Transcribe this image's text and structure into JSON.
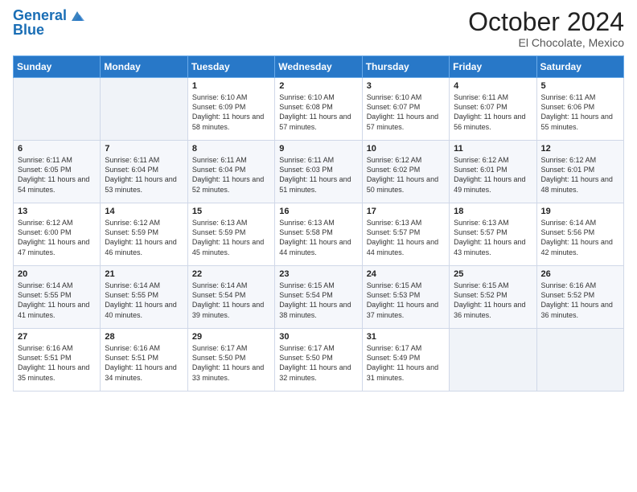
{
  "header": {
    "logo_general": "General",
    "logo_blue": "Blue",
    "month": "October 2024",
    "location": "El Chocolate, Mexico"
  },
  "days_of_week": [
    "Sunday",
    "Monday",
    "Tuesday",
    "Wednesday",
    "Thursday",
    "Friday",
    "Saturday"
  ],
  "weeks": [
    [
      {
        "day": "",
        "info": ""
      },
      {
        "day": "",
        "info": ""
      },
      {
        "day": "1",
        "info": "Sunrise: 6:10 AM\nSunset: 6:09 PM\nDaylight: 11 hours and 58 minutes."
      },
      {
        "day": "2",
        "info": "Sunrise: 6:10 AM\nSunset: 6:08 PM\nDaylight: 11 hours and 57 minutes."
      },
      {
        "day": "3",
        "info": "Sunrise: 6:10 AM\nSunset: 6:07 PM\nDaylight: 11 hours and 57 minutes."
      },
      {
        "day": "4",
        "info": "Sunrise: 6:11 AM\nSunset: 6:07 PM\nDaylight: 11 hours and 56 minutes."
      },
      {
        "day": "5",
        "info": "Sunrise: 6:11 AM\nSunset: 6:06 PM\nDaylight: 11 hours and 55 minutes."
      }
    ],
    [
      {
        "day": "6",
        "info": "Sunrise: 6:11 AM\nSunset: 6:05 PM\nDaylight: 11 hours and 54 minutes."
      },
      {
        "day": "7",
        "info": "Sunrise: 6:11 AM\nSunset: 6:04 PM\nDaylight: 11 hours and 53 minutes."
      },
      {
        "day": "8",
        "info": "Sunrise: 6:11 AM\nSunset: 6:04 PM\nDaylight: 11 hours and 52 minutes."
      },
      {
        "day": "9",
        "info": "Sunrise: 6:11 AM\nSunset: 6:03 PM\nDaylight: 11 hours and 51 minutes."
      },
      {
        "day": "10",
        "info": "Sunrise: 6:12 AM\nSunset: 6:02 PM\nDaylight: 11 hours and 50 minutes."
      },
      {
        "day": "11",
        "info": "Sunrise: 6:12 AM\nSunset: 6:01 PM\nDaylight: 11 hours and 49 minutes."
      },
      {
        "day": "12",
        "info": "Sunrise: 6:12 AM\nSunset: 6:01 PM\nDaylight: 11 hours and 48 minutes."
      }
    ],
    [
      {
        "day": "13",
        "info": "Sunrise: 6:12 AM\nSunset: 6:00 PM\nDaylight: 11 hours and 47 minutes."
      },
      {
        "day": "14",
        "info": "Sunrise: 6:12 AM\nSunset: 5:59 PM\nDaylight: 11 hours and 46 minutes."
      },
      {
        "day": "15",
        "info": "Sunrise: 6:13 AM\nSunset: 5:59 PM\nDaylight: 11 hours and 45 minutes."
      },
      {
        "day": "16",
        "info": "Sunrise: 6:13 AM\nSunset: 5:58 PM\nDaylight: 11 hours and 44 minutes."
      },
      {
        "day": "17",
        "info": "Sunrise: 6:13 AM\nSunset: 5:57 PM\nDaylight: 11 hours and 44 minutes."
      },
      {
        "day": "18",
        "info": "Sunrise: 6:13 AM\nSunset: 5:57 PM\nDaylight: 11 hours and 43 minutes."
      },
      {
        "day": "19",
        "info": "Sunrise: 6:14 AM\nSunset: 5:56 PM\nDaylight: 11 hours and 42 minutes."
      }
    ],
    [
      {
        "day": "20",
        "info": "Sunrise: 6:14 AM\nSunset: 5:55 PM\nDaylight: 11 hours and 41 minutes."
      },
      {
        "day": "21",
        "info": "Sunrise: 6:14 AM\nSunset: 5:55 PM\nDaylight: 11 hours and 40 minutes."
      },
      {
        "day": "22",
        "info": "Sunrise: 6:14 AM\nSunset: 5:54 PM\nDaylight: 11 hours and 39 minutes."
      },
      {
        "day": "23",
        "info": "Sunrise: 6:15 AM\nSunset: 5:54 PM\nDaylight: 11 hours and 38 minutes."
      },
      {
        "day": "24",
        "info": "Sunrise: 6:15 AM\nSunset: 5:53 PM\nDaylight: 11 hours and 37 minutes."
      },
      {
        "day": "25",
        "info": "Sunrise: 6:15 AM\nSunset: 5:52 PM\nDaylight: 11 hours and 36 minutes."
      },
      {
        "day": "26",
        "info": "Sunrise: 6:16 AM\nSunset: 5:52 PM\nDaylight: 11 hours and 36 minutes."
      }
    ],
    [
      {
        "day": "27",
        "info": "Sunrise: 6:16 AM\nSunset: 5:51 PM\nDaylight: 11 hours and 35 minutes."
      },
      {
        "day": "28",
        "info": "Sunrise: 6:16 AM\nSunset: 5:51 PM\nDaylight: 11 hours and 34 minutes."
      },
      {
        "day": "29",
        "info": "Sunrise: 6:17 AM\nSunset: 5:50 PM\nDaylight: 11 hours and 33 minutes."
      },
      {
        "day": "30",
        "info": "Sunrise: 6:17 AM\nSunset: 5:50 PM\nDaylight: 11 hours and 32 minutes."
      },
      {
        "day": "31",
        "info": "Sunrise: 6:17 AM\nSunset: 5:49 PM\nDaylight: 11 hours and 31 minutes."
      },
      {
        "day": "",
        "info": ""
      },
      {
        "day": "",
        "info": ""
      }
    ]
  ]
}
